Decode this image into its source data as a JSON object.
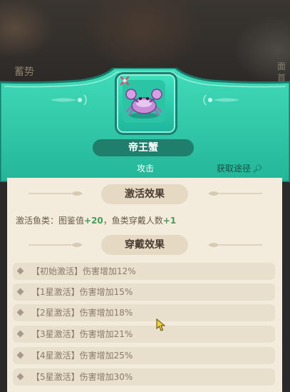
{
  "background": {
    "corner_label": "蓄势",
    "side_label_1": "面",
    "side_label_2": "首"
  },
  "header": {
    "item_name": "帝王蟹",
    "item_type": "攻击",
    "acquire_link": "获取途径"
  },
  "sections": {
    "activate_title": "激活效果",
    "wear_title": "穿戴效果"
  },
  "activate_effect": {
    "prefix": "激活鱼类：图鉴值",
    "value1": "+20",
    "middle": "，鱼类穿戴人数",
    "value2": "+1"
  },
  "wear_effects": [
    {
      "label": "【初始激活】伤害增加12%"
    },
    {
      "label": "【1星激活】伤害增加15%"
    },
    {
      "label": "【2星激活】伤害增加18%"
    },
    {
      "label": "【3星激活】伤害增加21%"
    },
    {
      "label": "【4星激活】伤害增加25%"
    },
    {
      "label": "【5星激活】伤害增加30%"
    }
  ],
  "colors": {
    "panel_green": "#2cc6a4",
    "panel_body": "#f3ecdc",
    "highlight_green": "#4a9a5a"
  }
}
